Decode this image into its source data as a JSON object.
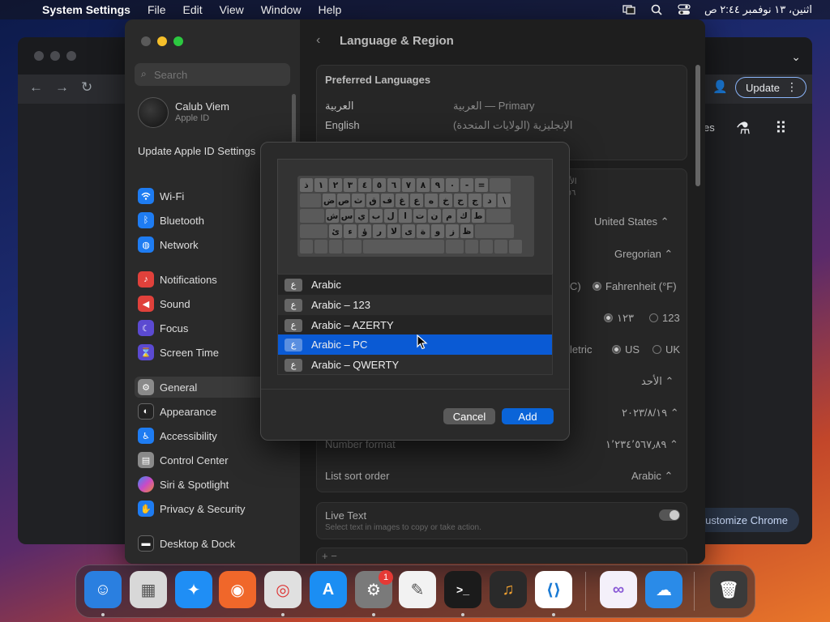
{
  "menubar": {
    "app_name": "System Settings",
    "menus": [
      "File",
      "Edit",
      "View",
      "Window",
      "Help"
    ],
    "clock": "اثنين، ١٣ نوفمبر ٢:٤٤ ص"
  },
  "chrome": {
    "update_label": "Update",
    "partial_label": "es",
    "customize_label": "ustomize Chrome"
  },
  "settings": {
    "search_placeholder": "Search",
    "profile": {
      "name": "Calub Viem",
      "sub": "Apple ID"
    },
    "update_apple_id": "Update Apple ID Settings",
    "sidebar_items": [
      {
        "label": "Wi-Fi",
        "icon": "wifi-icon",
        "color": "#1e7cf2"
      },
      {
        "label": "Bluetooth",
        "icon": "bluetooth-icon",
        "color": "#1e7cf2"
      },
      {
        "label": "Network",
        "icon": "globe-icon",
        "color": "#1e7cf2"
      },
      {
        "label": "Notifications",
        "icon": "bell-icon",
        "color": "#e0413b"
      },
      {
        "label": "Sound",
        "icon": "speaker-icon",
        "color": "#e0413b"
      },
      {
        "label": "Focus",
        "icon": "moon-icon",
        "color": "#5b4ad1"
      },
      {
        "label": "Screen Time",
        "icon": "hourglass-icon",
        "color": "#5b4ad1"
      },
      {
        "label": "General",
        "icon": "gear-icon",
        "color": "#8a8a8a"
      },
      {
        "label": "Appearance",
        "icon": "appearance-icon",
        "color": "#222222"
      },
      {
        "label": "Accessibility",
        "icon": "accessibility-icon",
        "color": "#1e7cf2"
      },
      {
        "label": "Control Center",
        "icon": "control-center-icon",
        "color": "#8a8a8a"
      },
      {
        "label": "Siri & Spotlight",
        "icon": "siri-icon",
        "color": "#c94ac7"
      },
      {
        "label": "Privacy & Security",
        "icon": "hand-icon",
        "color": "#1e7cf2"
      },
      {
        "label": "Desktop & Dock",
        "icon": "dock-icon",
        "color": "#222222"
      }
    ],
    "content_title": "Language & Region",
    "preferred_header": "Preferred Languages",
    "languages": [
      {
        "name": "العربية",
        "detail": "العربية — Primary"
      },
      {
        "name": "English",
        "detail": "الإنجليزية (الولايات المتحدة)"
      }
    ],
    "partial_preview": "الأ",
    "partial_preview2": "٤،٥٦",
    "region_value": "United States",
    "calendar_value": "Gregorian",
    "temp_c_fragment": "C)",
    "temp_f": "Fahrenheit (°F)",
    "numerals_arabic": "١٢٣",
    "numerals_latin": "123",
    "measure_fragment": "letric",
    "measure_us": "US",
    "measure_uk": "UK",
    "first_day_value": "الأحد",
    "date_format_value": "٢٠٢٣/٨/١٩",
    "number_format_label": "Number format",
    "number_format_value": "١٬٢٣٤٬٥٦٧٫٨٩",
    "sort_label": "List sort order",
    "sort_value": "Arabic",
    "live_text_label": "Live Text",
    "live_text_sub": "Select text in images to copy or take action.",
    "add_remove": "+  −"
  },
  "sheet": {
    "keyboard_rows": [
      [
        "ذ",
        "١",
        "٢",
        "٣",
        "٤",
        "٥",
        "٦",
        "٧",
        "٨",
        "٩",
        "٠",
        "-",
        "=",
        ""
      ],
      [
        "",
        "ض",
        "ص",
        "ث",
        "ق",
        "ف",
        "غ",
        "ع",
        "ه",
        "خ",
        "ح",
        "ج",
        "د",
        "\\"
      ],
      [
        "",
        "ش",
        "س",
        "ي",
        "ب",
        "ل",
        "ا",
        "ت",
        "ن",
        "م",
        "ك",
        "ط",
        ""
      ],
      [
        "",
        "ئ",
        "ء",
        "ؤ",
        "ر",
        "لا",
        "ى",
        "ة",
        "و",
        "ز",
        "ظ",
        ""
      ],
      [
        "",
        "",
        "",
        "",
        "",
        "",
        "",
        "",
        "",
        "",
        "",
        ""
      ]
    ],
    "badge_glyph": "ع",
    "layouts": [
      "Arabic",
      "Arabic – 123",
      "Arabic – AZERTY",
      "Arabic – PC",
      "Arabic – QWERTY"
    ],
    "selected_index": 3,
    "cancel_label": "Cancel",
    "add_label": "Add"
  },
  "dock": {
    "apps": [
      {
        "name": "finder-icon",
        "color": "#2a7fe0",
        "glyph": "☺"
      },
      {
        "name": "launchpad-icon",
        "color": "#d8d8d8",
        "glyph": "▦"
      },
      {
        "name": "safari-icon",
        "color": "#1f8ef5",
        "glyph": "✦"
      },
      {
        "name": "firefox-icon",
        "color": "#f0672a",
        "glyph": "◉"
      },
      {
        "name": "chrome-icon",
        "color": "#e0e0e0",
        "glyph": "◎"
      },
      {
        "name": "app-store-icon",
        "color": "#1b8ef3",
        "glyph": "A"
      },
      {
        "name": "system-settings-icon",
        "color": "#7a7a7a",
        "glyph": "⚙"
      },
      {
        "name": "textedit-icon",
        "color": "#f2f2f2",
        "glyph": "✎"
      },
      {
        "name": "terminal-icon",
        "color": "#1b1b1b",
        "glyph": ">_"
      },
      {
        "name": "garageband-icon",
        "color": "#2a2a2a",
        "glyph": "♫"
      },
      {
        "name": "vscode-icon",
        "color": "#ffffff",
        "glyph": "⟨⟩"
      },
      {
        "name": "visual-studio-icon",
        "color": "#f4f0fa",
        "glyph": "∞"
      },
      {
        "name": "weather-icon",
        "color": "#2a8be8",
        "glyph": "☁"
      },
      {
        "name": "trash-icon",
        "color": "#3a3a3a",
        "glyph": "🗑"
      }
    ],
    "settings_badge": "1"
  }
}
